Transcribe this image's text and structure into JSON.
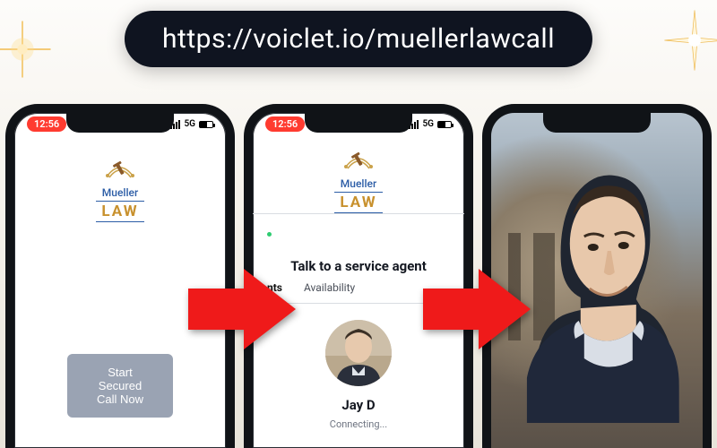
{
  "url_display": "https://voiclet.io/muellerlawcall",
  "status": {
    "time": "12:56",
    "network": "5G"
  },
  "brand": {
    "line1": "Mueller",
    "line2": "LAW"
  },
  "phone1": {
    "cta": "Start Secured Call Now"
  },
  "phone2": {
    "heading": "Talk to a service agent",
    "tab_agents": "nts",
    "tab_availability": "Availability",
    "agent_name": "Jay D",
    "agent_status": "Connecting..."
  }
}
